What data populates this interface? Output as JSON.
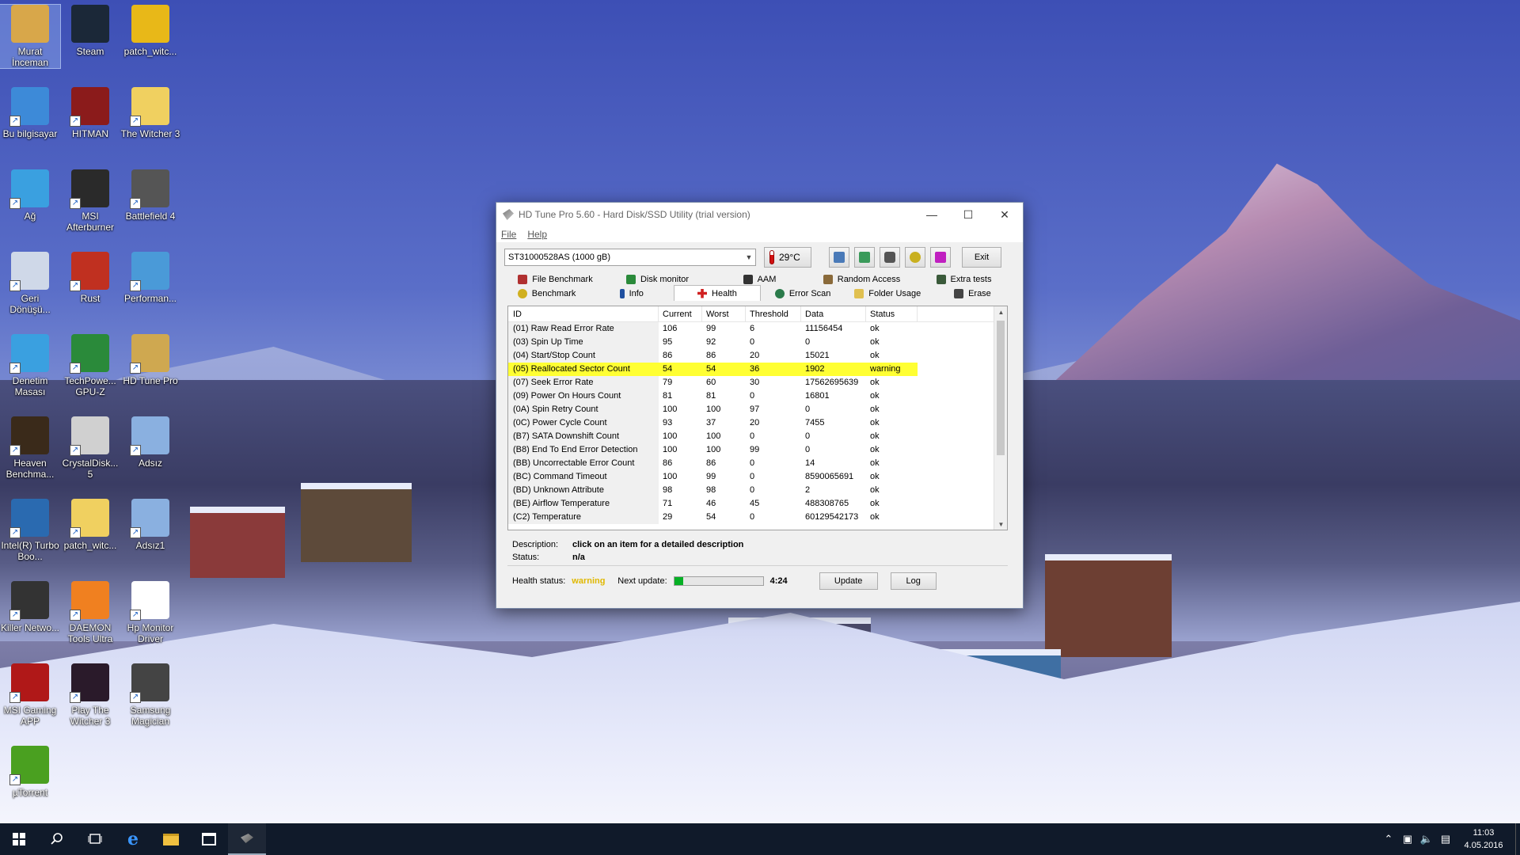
{
  "desktop": {
    "icons": [
      {
        "label": "Murat İnceman",
        "icon": "user-folder-icon"
      },
      {
        "label": "Steam",
        "icon": "steam-icon"
      },
      {
        "label": "patch_witc...",
        "icon": "disc-image-icon"
      },
      {
        "label": "Bu bilgisayar",
        "icon": "computer-icon"
      },
      {
        "label": "HITMAN",
        "icon": "hitman-icon"
      },
      {
        "label": "The Witcher 3",
        "icon": "folder-icon"
      },
      {
        "label": "Ağ",
        "icon": "network-icon"
      },
      {
        "label": "MSI Afterburner",
        "icon": "afterburner-icon"
      },
      {
        "label": "Battlefield 4",
        "icon": "battlefield-icon"
      },
      {
        "label": "Geri Dönüşü...",
        "icon": "recycle-bin-icon"
      },
      {
        "label": "Rust",
        "icon": "rust-icon"
      },
      {
        "label": "Performan...",
        "icon": "performance-icon"
      },
      {
        "label": "Denetim Masası",
        "icon": "control-panel-icon"
      },
      {
        "label": "TechPowe... GPU-Z",
        "icon": "gpuz-icon"
      },
      {
        "label": "HD Tune Pro",
        "icon": "hdtune-icon"
      },
      {
        "label": "Heaven Benchma...",
        "icon": "heaven-icon"
      },
      {
        "label": "CrystalDisk... 5",
        "icon": "crystaldisk-icon"
      },
      {
        "label": "Adsız",
        "icon": "image-icon"
      },
      {
        "label": "Intel(R) Turbo Boo...",
        "icon": "intel-turbo-icon"
      },
      {
        "label": "patch_witc...",
        "icon": "folder-icon"
      },
      {
        "label": "Adsız1",
        "icon": "image-icon"
      },
      {
        "label": "Killer Netwo...",
        "icon": "killer-network-icon"
      },
      {
        "label": "DAEMON Tools Ultra",
        "icon": "daemon-tools-icon"
      },
      {
        "label": "Hp Monitor Driver",
        "icon": "hp-icon"
      },
      {
        "label": "MSI Gaming APP",
        "icon": "msi-gaming-icon"
      },
      {
        "label": "Play The Witcher 3",
        "icon": "witcher-icon"
      },
      {
        "label": "Samsung Magician",
        "icon": "samsung-magician-icon"
      },
      {
        "label": "µTorrent",
        "icon": "utorrent-icon"
      }
    ]
  },
  "window": {
    "title": "HD Tune Pro 5.60 - Hard Disk/SSD Utility (trial version)",
    "menu": [
      "File",
      "Help"
    ],
    "drive": "ST31000528AS (1000 gB)",
    "temperature": "29°C",
    "exit_label": "Exit",
    "tabs_row1": [
      "File Benchmark",
      "Disk monitor",
      "AAM",
      "Random Access",
      "Extra tests"
    ],
    "tabs_row2": [
      "Benchmark",
      "Info",
      "Health",
      "Error Scan",
      "Folder Usage",
      "Erase"
    ],
    "active_tab": "Health",
    "columns": [
      "ID",
      "Current",
      "Worst",
      "Threshold",
      "Data",
      "Status"
    ],
    "rows": [
      [
        "(01) Raw Read Error Rate",
        "106",
        "99",
        "6",
        "11156454",
        "ok"
      ],
      [
        "(03) Spin Up Time",
        "95",
        "92",
        "0",
        "0",
        "ok"
      ],
      [
        "(04) Start/Stop Count",
        "86",
        "86",
        "20",
        "15021",
        "ok"
      ],
      [
        "(05) Reallocated Sector Count",
        "54",
        "54",
        "36",
        "1902",
        "warning"
      ],
      [
        "(07) Seek Error Rate",
        "79",
        "60",
        "30",
        "17562695639",
        "ok"
      ],
      [
        "(09) Power On Hours Count",
        "81",
        "81",
        "0",
        "16801",
        "ok"
      ],
      [
        "(0A) Spin Retry Count",
        "100",
        "100",
        "97",
        "0",
        "ok"
      ],
      [
        "(0C) Power Cycle Count",
        "93",
        "37",
        "20",
        "7455",
        "ok"
      ],
      [
        "(B7) SATA Downshift Count",
        "100",
        "100",
        "0",
        "0",
        "ok"
      ],
      [
        "(B8) End To End Error Detection",
        "100",
        "100",
        "99",
        "0",
        "ok"
      ],
      [
        "(BB) Uncorrectable Error Count",
        "86",
        "86",
        "0",
        "14",
        "ok"
      ],
      [
        "(BC) Command Timeout",
        "100",
        "99",
        "0",
        "8590065691",
        "ok"
      ],
      [
        "(BD) Unknown Attribute",
        "98",
        "98",
        "0",
        "2",
        "ok"
      ],
      [
        "(BE) Airflow Temperature",
        "71",
        "46",
        "45",
        "488308765",
        "ok"
      ],
      [
        "(C2) Temperature",
        "29",
        "54",
        "0",
        "60129542173",
        "ok"
      ]
    ],
    "highlighted_row": 3,
    "description_label": "Description:",
    "description_value": "click on an item for a detailed description",
    "status_label": "Status:",
    "status_value": "n/a",
    "health_status_label": "Health status:",
    "health_status_value": "warning",
    "next_update_label": "Next update:",
    "next_update_progress": 0.1,
    "next_update_time": "4:24",
    "update_label": "Update",
    "log_label": "Log",
    "colors": {
      "warning": "#e0b800",
      "highlight": "#ffff33",
      "progress": "#06b025"
    }
  },
  "taskbar": {
    "clock_time": "11:03",
    "clock_date": "4.05.2016"
  }
}
